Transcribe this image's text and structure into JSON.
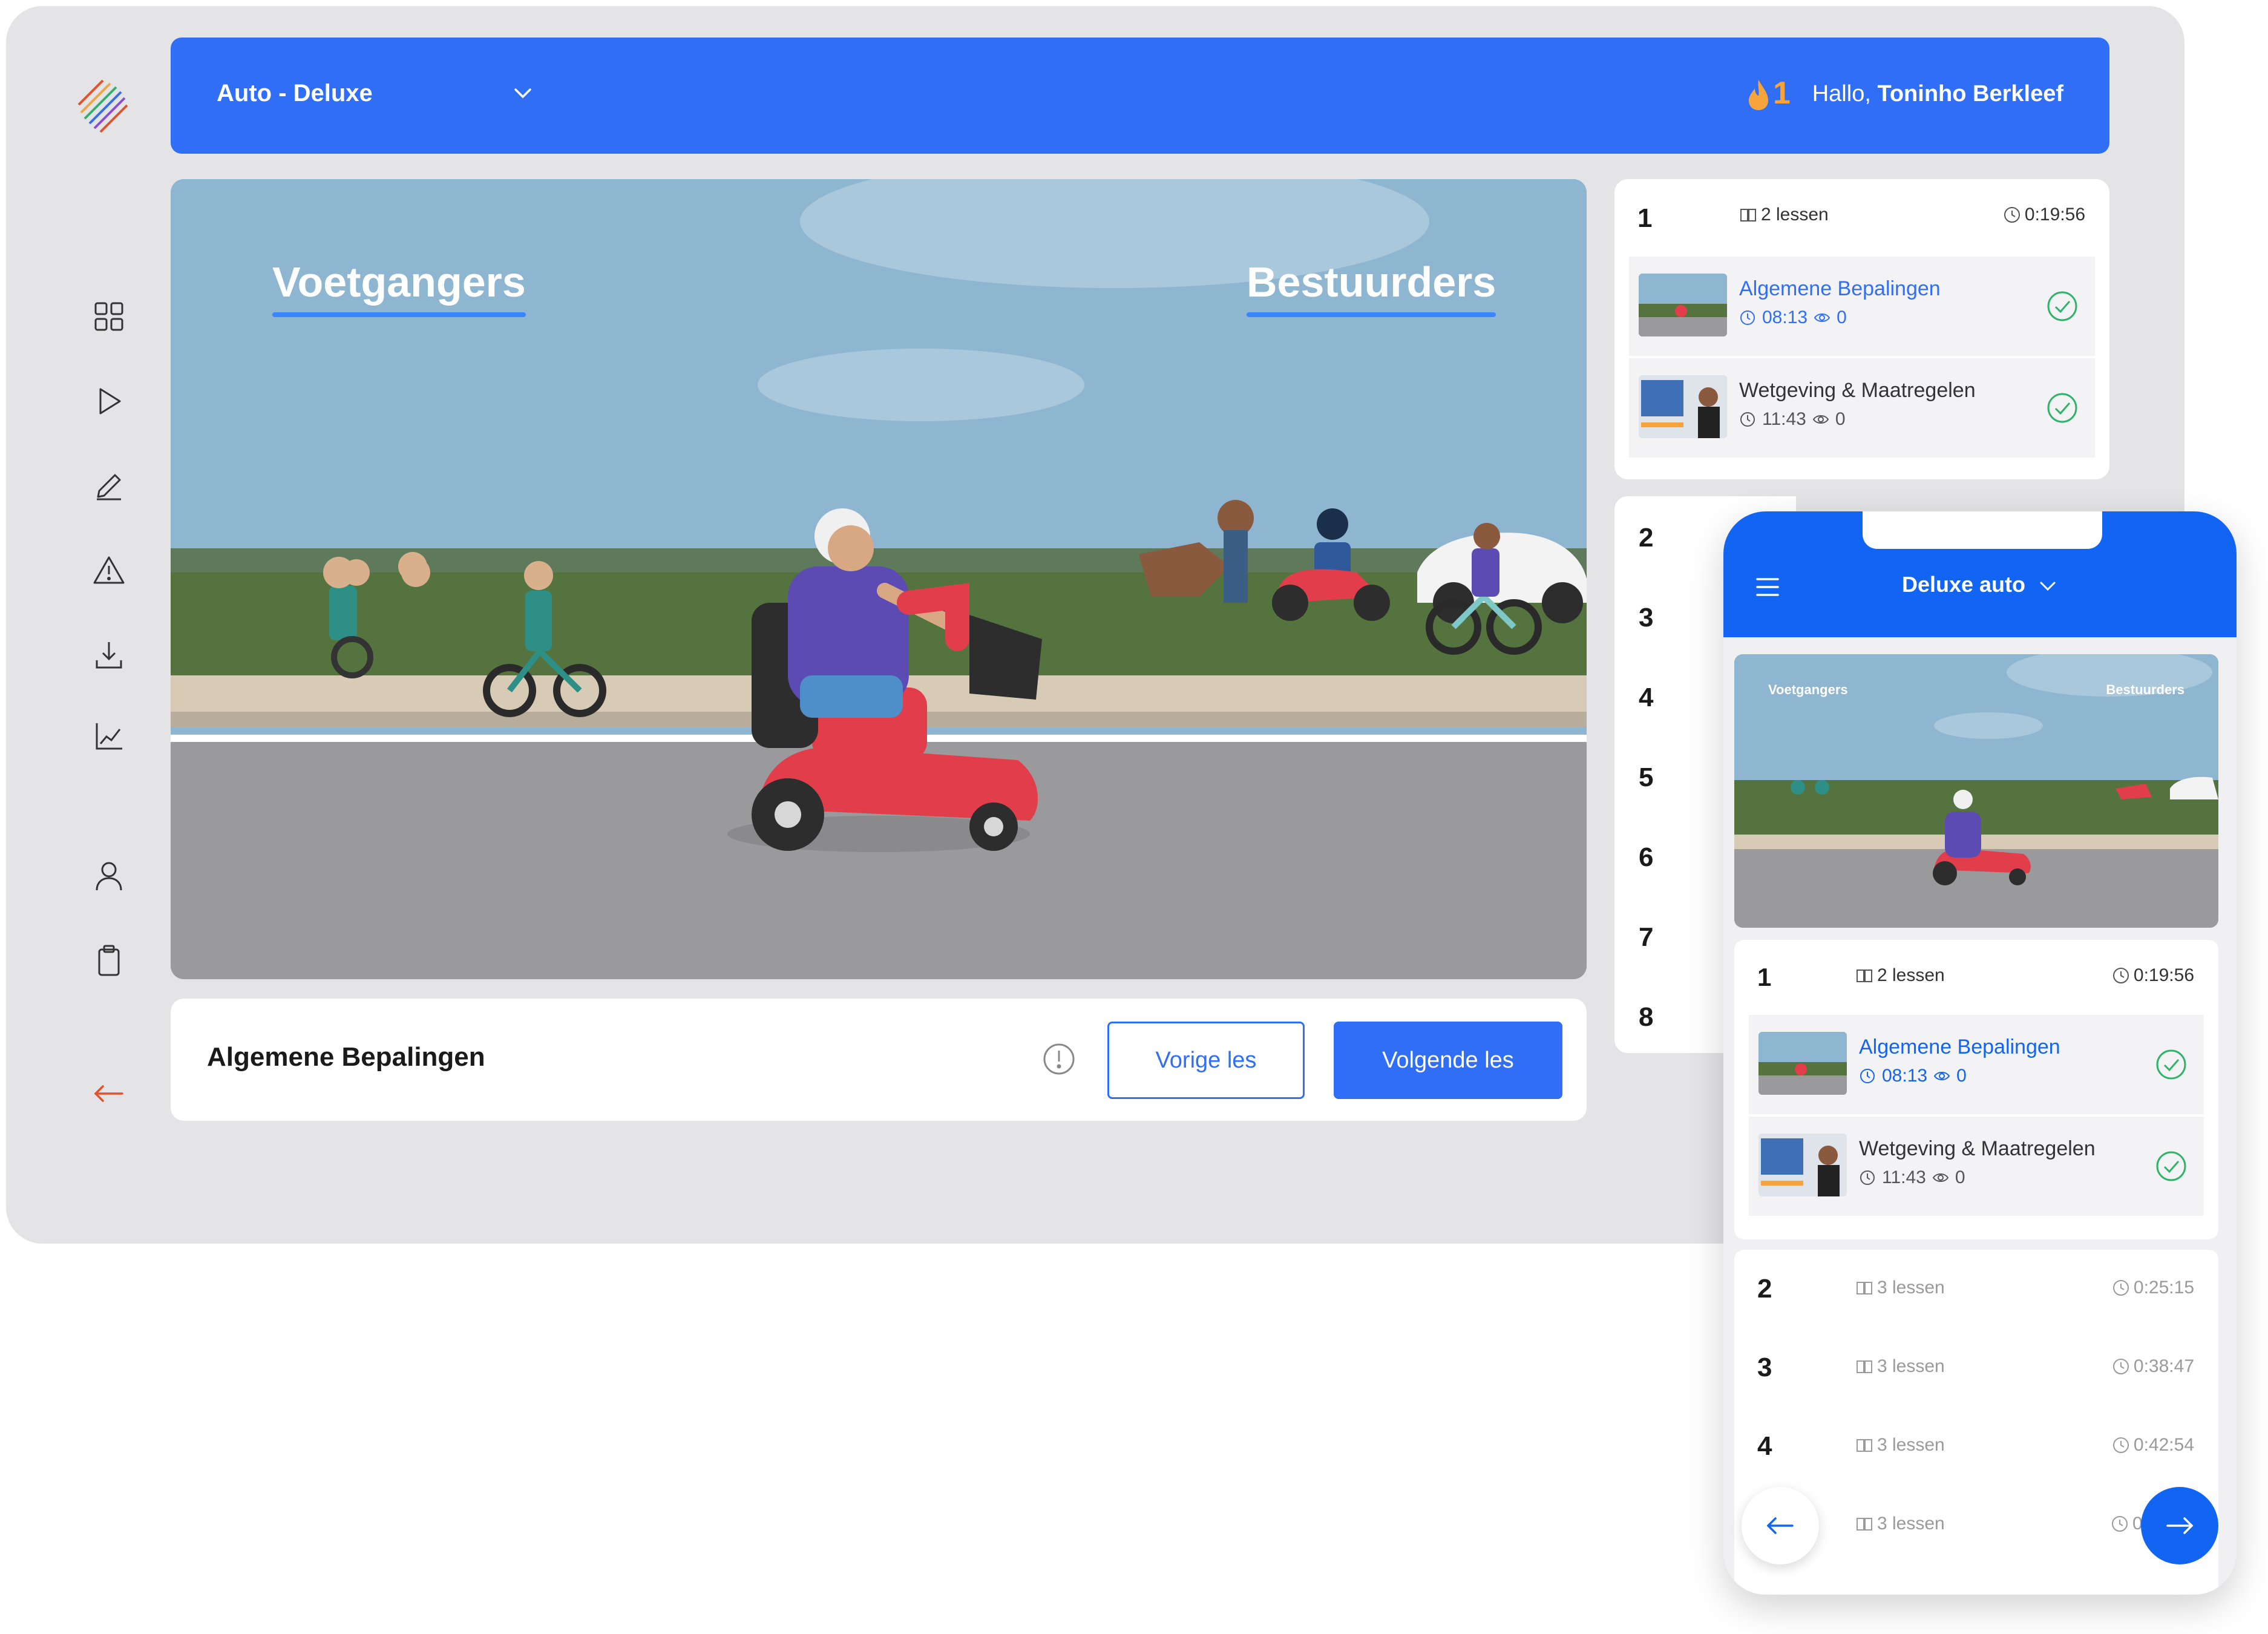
{
  "header": {
    "course": "Auto - Deluxe",
    "streak": "1",
    "greeting": "Hallo,",
    "user_name": "Toninho Berkleef"
  },
  "video": {
    "label_left": "Voetgangers",
    "label_right": "Bestuurders"
  },
  "lesson_bar": {
    "title": "Algemene Bepalingen",
    "prev_label": "Vorige les",
    "next_label": "Volgende les"
  },
  "chapter1": {
    "number": "1",
    "lessons": "2 lessen",
    "duration": "0:19:56",
    "items": [
      {
        "title": "Algemene Bepalingen",
        "time": "08:13",
        "views": "0"
      },
      {
        "title": "Wetgeving & Maatregelen",
        "time": "11:43",
        "views": "0"
      }
    ]
  },
  "chapter_numbers": [
    "2",
    "3",
    "4",
    "5",
    "6",
    "7",
    "8"
  ],
  "phone": {
    "course": "Deluxe auto",
    "video_label_left": "Voetgangers",
    "video_label_right": "Bestuurders",
    "chapters": [
      {
        "number": "2",
        "lessons": "3 lessen",
        "duration": "0:25:15"
      },
      {
        "number": "3",
        "lessons": "3 lessen",
        "duration": "0:38:47"
      },
      {
        "number": "4",
        "lessons": "3 lessen",
        "duration": "0:42:54"
      },
      {
        "number": "",
        "lessons": "3 lessen",
        "duration": "0"
      }
    ]
  },
  "colors": {
    "primary": "#2f6ef5",
    "phone_primary": "#1264f2",
    "check": "#2fb36b",
    "streak": "#f7a43a",
    "logout": "#e4512b"
  }
}
